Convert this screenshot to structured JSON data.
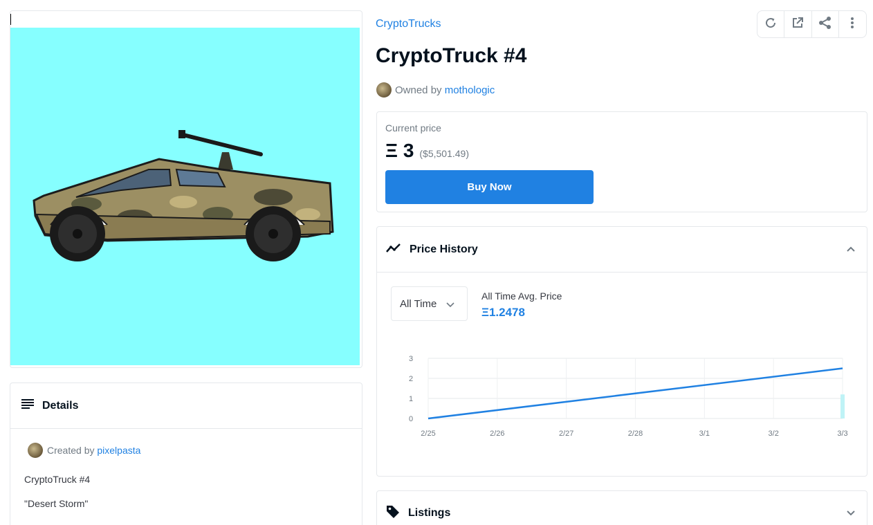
{
  "collection": {
    "name": "CryptoTrucks"
  },
  "asset": {
    "title": "CryptoTruck #4",
    "owned_by_label": "Owned by",
    "owner": "mothologic",
    "image_bg": "#86ffff"
  },
  "toolbar": {
    "icons": [
      "refresh-icon",
      "external-link-icon",
      "share-icon",
      "more-icon"
    ]
  },
  "price": {
    "label": "Current price",
    "currency_symbol": "Ξ",
    "value": "3",
    "usd": "($5,501.49)",
    "buy_label": "Buy Now"
  },
  "price_history": {
    "title": "Price History",
    "range": "All Time",
    "avg_label": "All Time Avg. Price",
    "avg_value": "Ξ1.2478"
  },
  "chart_data": {
    "type": "line",
    "x": [
      "2/25",
      "2/26",
      "2/27",
      "2/28",
      "3/1",
      "3/2",
      "3/3"
    ],
    "yticks": [
      0,
      1,
      2,
      3
    ],
    "ylim": [
      0,
      3
    ],
    "series": [
      {
        "points": [
          [
            0,
            0
          ],
          [
            6,
            2.5
          ]
        ]
      }
    ],
    "volume": [
      {
        "x": 6,
        "value": 1.2
      }
    ],
    "grid": true,
    "accent": "#2081e2",
    "volume_color": "#bff3f6"
  },
  "details": {
    "title": "Details",
    "created_by_label": "Created by",
    "creator": "pixelpasta",
    "lines": [
      "CryptoTruck #4",
      "\"Desert Storm\""
    ]
  },
  "listings": {
    "title": "Listings"
  }
}
